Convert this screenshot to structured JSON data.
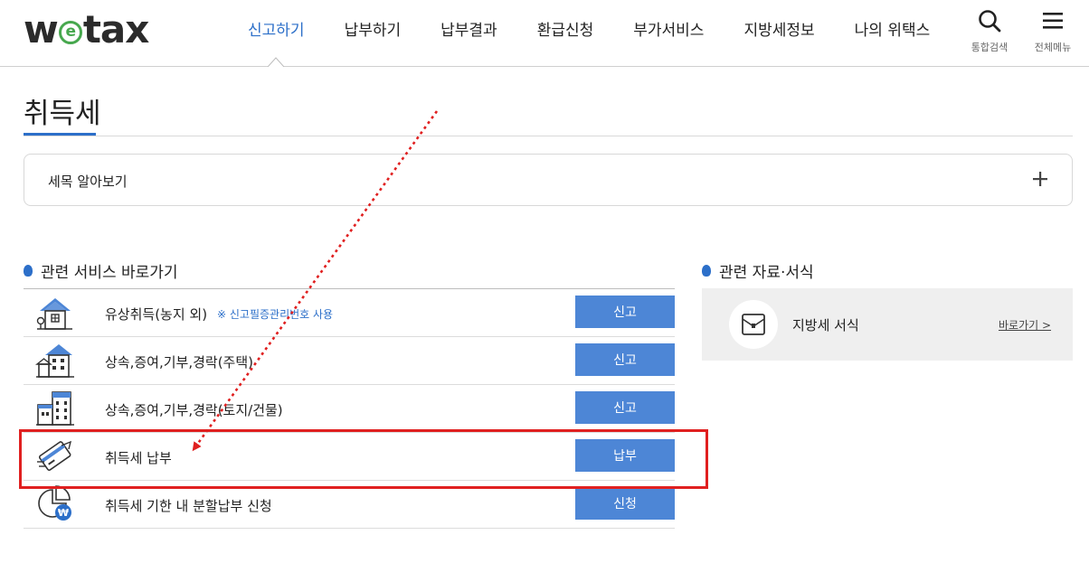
{
  "header": {
    "logo_prefix": "w",
    "logo_e": "e",
    "logo_suffix": "tax",
    "nav": [
      {
        "label": "신고하기",
        "active": true
      },
      {
        "label": "납부하기",
        "active": false
      },
      {
        "label": "납부결과",
        "active": false
      },
      {
        "label": "환급신청",
        "active": false
      },
      {
        "label": "부가서비스",
        "active": false
      },
      {
        "label": "지방세정보",
        "active": false
      },
      {
        "label": "나의 위택스",
        "active": false
      }
    ],
    "search_label": "통합검색",
    "menu_label": "전체메뉴"
  },
  "page": {
    "title": "취득세"
  },
  "accordion": {
    "label": "세목 알아보기"
  },
  "services": {
    "heading": "관련 서비스 바로가기",
    "items": [
      {
        "name": "유상취득(농지 외)",
        "note": "※ 신고필증관리번호 사용",
        "button": "신고",
        "icon": "house-icon"
      },
      {
        "name": "상속,증여,기부,경락(주택)",
        "note": "",
        "button": "신고",
        "icon": "apartment-house-icon"
      },
      {
        "name": "상속,증여,기부,경락(토지/건물)",
        "note": "",
        "button": "신고",
        "icon": "building-icon"
      },
      {
        "name": "취득세 납부",
        "note": "",
        "button": "납부",
        "icon": "card-payment-icon"
      },
      {
        "name": "취득세 기한 내 분할납부 신청",
        "note": "",
        "button": "신청",
        "icon": "won-pie-chart-icon"
      }
    ]
  },
  "resources": {
    "heading": "관련 자료·서식",
    "item_name": "지방세 서식",
    "link": "바로가기 >"
  },
  "colors": {
    "accent": "#2c6fc9",
    "button": "#4d86d6",
    "logo_green": "#47a84e",
    "highlight": "#e02020"
  }
}
